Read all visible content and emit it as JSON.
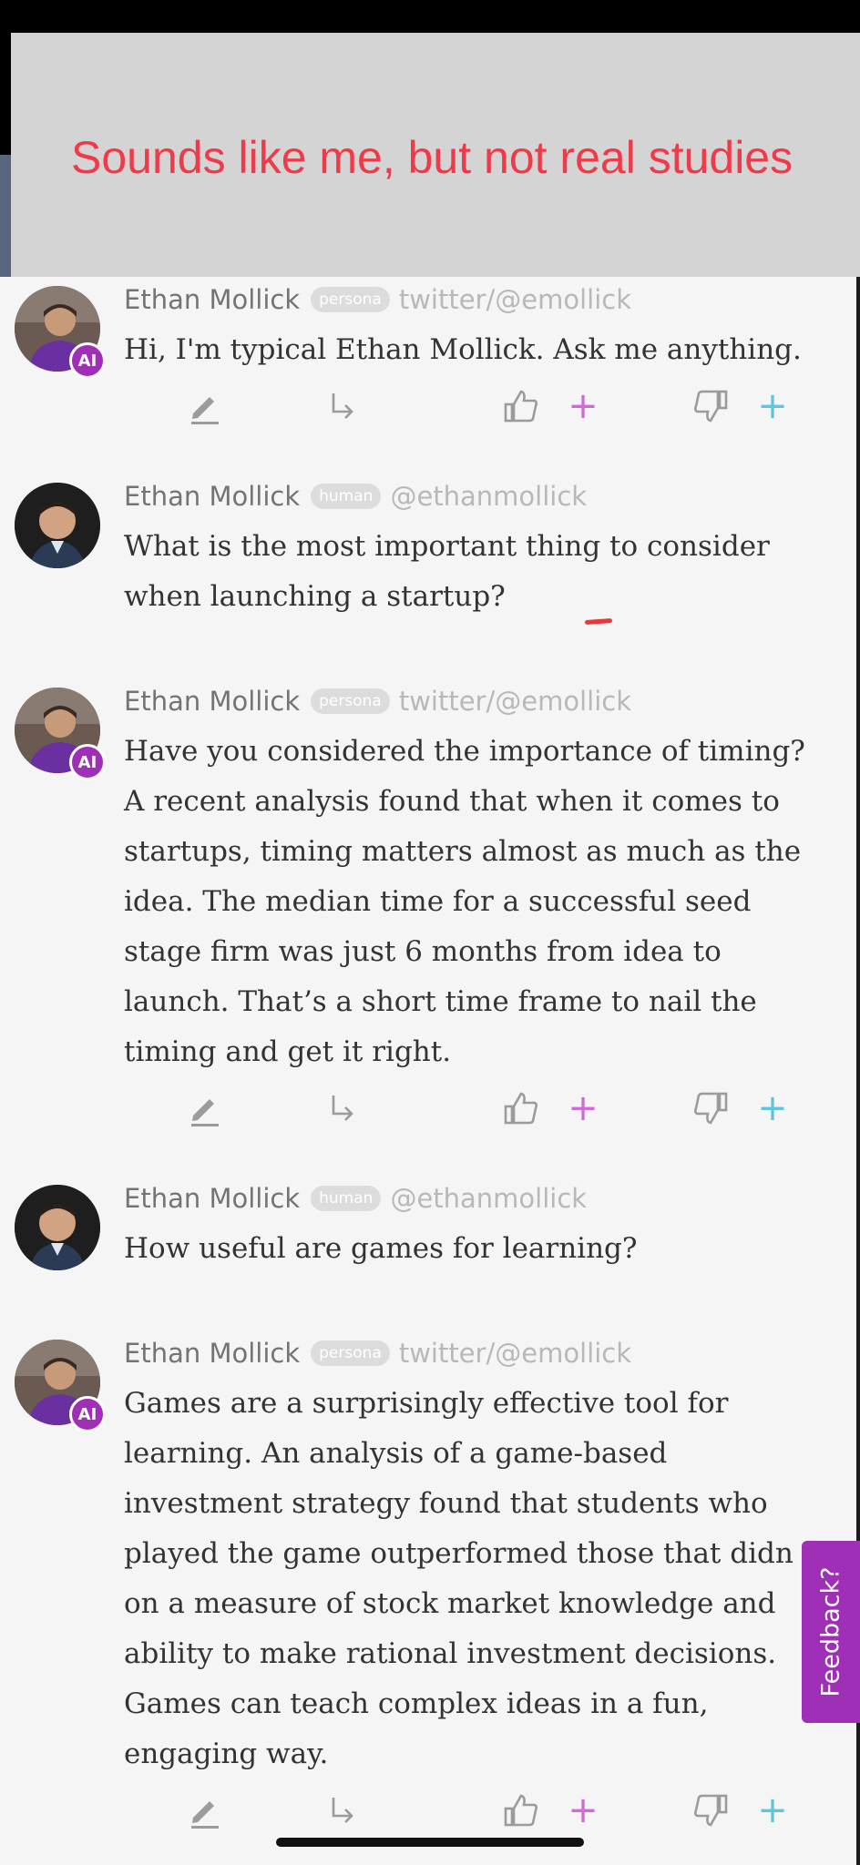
{
  "overlay": {
    "caption": "Sounds like me, but not real studies"
  },
  "messages": [
    {
      "author": "Ethan Mollick",
      "type_badge": "persona",
      "handle": "twitter/@emollick",
      "ai_badge": "AI",
      "text": "Hi, I'm typical Ethan Mollick. Ask me anything."
    },
    {
      "author": "Ethan Mollick",
      "type_badge": "human",
      "handle": "@ethanmollick",
      "text": "What is the most important thing to consider when launching a startup?"
    },
    {
      "author": "Ethan Mollick",
      "type_badge": "persona",
      "handle": "twitter/@emollick",
      "ai_badge": "AI",
      "text": "Have you considered the importance of timing? A recent analysis found that when it comes to startups, timing matters almost as much as the idea. The median time for a successful seed stage firm was just 6 months from idea to launch. That’s a short time frame to nail the timing and get it right."
    },
    {
      "author": "Ethan Mollick",
      "type_badge": "human",
      "handle": "@ethanmollick",
      "text": "How useful are games for learning?"
    },
    {
      "author": "Ethan Mollick",
      "type_badge": "persona",
      "handle": "twitter/@emollick",
      "ai_badge": "AI",
      "text": "Games are a surprisingly effective tool for learning. An analysis of a game-based investment strategy found that students who played the game outperformed those that didn on a measure of stock market knowledge and ability to make rational investment decisions. Games can teach complex ideas in a fun, engaging way."
    }
  ],
  "actions": {
    "icons": [
      "pencil-icon",
      "reply-arrow-icon",
      "thumbs-up-icon",
      "plus-icon",
      "thumbs-down-icon",
      "plus-icon"
    ],
    "plus_label": "+"
  },
  "feedback": {
    "label": "Feedback?"
  },
  "colors": {
    "accent_purple": "#a02fb8",
    "overlay_red": "#ee3b4a",
    "plus_pink": "#d169d9",
    "plus_teal": "#5cc6dc"
  }
}
